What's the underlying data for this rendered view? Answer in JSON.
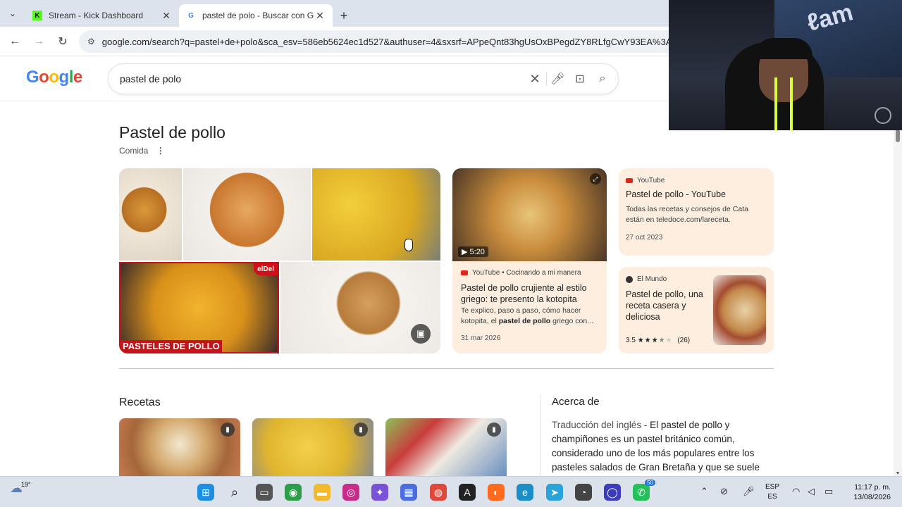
{
  "browser": {
    "tabs": [
      {
        "title": "Stream - Kick Dashboard",
        "active": false
      },
      {
        "title": "pastel de polo - Buscar con Goo",
        "active": true
      }
    ],
    "url": "google.com/search?q=pastel+de+polo&sca_esv=586eb5624ec1d527&authuser=4&sxsrf=APpeQnt83hgUsOxBPegdZY8RLfgCwY93EA%3A"
  },
  "google": {
    "logo": "Google",
    "query": "pastel de polo"
  },
  "knowledge": {
    "title": "Pastel de pollo",
    "subtitle": "Comida",
    "image_labels": {
      "red_label": "PASTELES DE POLLO",
      "red_badge": "elDel"
    },
    "video_card": {
      "duration": "5:20",
      "source": "YouTube • Cocinando a mi manera",
      "title": "Pastel de pollo crujiente al estilo griego: te presento la kotopita",
      "desc_pre": "Te explico, paso a paso, cómo hacer kotopita, el ",
      "desc_bold": "pastel de pollo",
      "desc_post": " griego con...",
      "date": "31 mar 2026"
    },
    "youtube_card": {
      "source": "YouTube",
      "title": "Pastel de pollo - YouTube",
      "desc": "Todas las recetas y consejos de Cata están en teledoce.com/lareceta.",
      "date": "27 oct 2023"
    },
    "elmundo_card": {
      "source": "El Mundo",
      "title": "Pastel de pollo, una receta casera y deliciosa",
      "rating": "3.5",
      "reviews": "(26)"
    }
  },
  "recetas": {
    "heading": "Recetas"
  },
  "about": {
    "heading": "Acerca de",
    "lead": "Traducción del inglés - ",
    "text": "El pastel de pollo y champiñones es un pastel británico común, considerado uno de los más populares entre los pasteles salados de Gran Bretaña y que se suele"
  },
  "taskbar": {
    "temperature": "19°",
    "notification_count": "50",
    "lang_top": "ESP",
    "lang_bottom": "ES",
    "time": "11:17 p. m.",
    "date": "13/08/2026"
  }
}
